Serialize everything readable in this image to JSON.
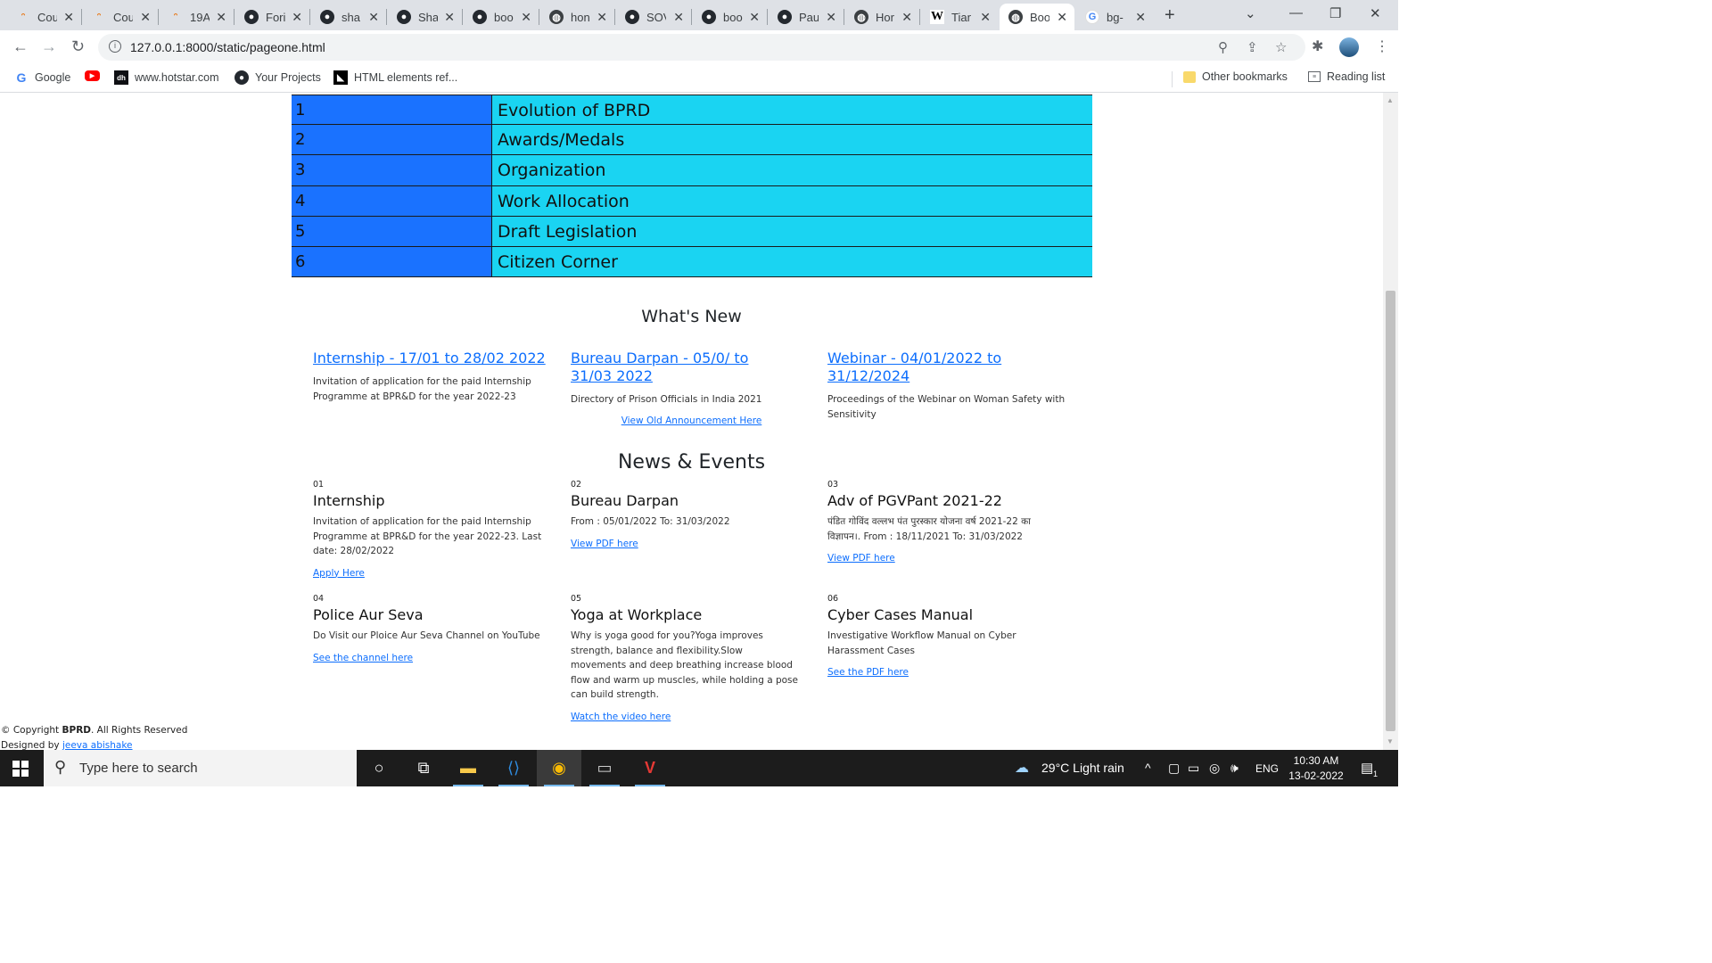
{
  "browser": {
    "tabs": [
      {
        "label": "Cou",
        "icon": "rss-icon"
      },
      {
        "label": "Cou",
        "icon": "rss-icon"
      },
      {
        "label": "19A",
        "icon": "rss-icon"
      },
      {
        "label": "Fori",
        "icon": "github-icon"
      },
      {
        "label": "sha",
        "icon": "github-icon"
      },
      {
        "label": "Sha",
        "icon": "github-icon"
      },
      {
        "label": "boo",
        "icon": "github-icon"
      },
      {
        "label": "hon",
        "icon": "globe-icon"
      },
      {
        "label": "SOV",
        "icon": "github-icon"
      },
      {
        "label": "boo",
        "icon": "github-icon"
      },
      {
        "label": "Pau",
        "icon": "github-icon"
      },
      {
        "label": "Hor",
        "icon": "globe-icon"
      },
      {
        "label": "Tian",
        "icon": "wikipedia-icon"
      },
      {
        "label": "Boo",
        "icon": "globe-icon",
        "active": true
      },
      {
        "label": "bg-",
        "icon": "google-icon"
      }
    ],
    "url": "127.0.0.1:8000/static/pageone.html",
    "bookmarks": [
      {
        "label": "Google",
        "icon": "google-icon"
      },
      {
        "label": "",
        "icon": "youtube-icon"
      },
      {
        "label": "www.hotstar.com",
        "icon": "hotstar-icon"
      },
      {
        "label": "Your Projects",
        "icon": "github-icon"
      },
      {
        "label": "HTML elements ref...",
        "icon": "mdn-icon"
      }
    ],
    "other_bookmarks": "Other bookmarks",
    "reading_list": "Reading list"
  },
  "page": {
    "menu": [
      {
        "num": "1",
        "label": "Evolution of BPRD"
      },
      {
        "num": "2",
        "label": "Awards/Medals"
      },
      {
        "num": "3",
        "label": "Organization"
      },
      {
        "num": "4",
        "label": "Work Allocation"
      },
      {
        "num": "5",
        "label": "Draft Legislation"
      },
      {
        "num": "6",
        "label": "Citizen Corner"
      }
    ],
    "whats_new": {
      "heading": "What's New",
      "items": [
        {
          "title": "Internship - 17/01 to 28/02 2022",
          "desc": "Invitation of application for the paid Internship Programme at BPR&D for the year 2022-23"
        },
        {
          "title": "Bureau Darpan - 05/0/ to 31/03 2022",
          "desc": "Directory of Prison Officials in India 2021"
        },
        {
          "title": "Webinar - 04/01/2022 to 31/12/2024",
          "desc": "Proceedings of the Webinar on Woman Safety with Sensitivity"
        }
      ],
      "old_link": "View Old Announcement Here"
    },
    "news": {
      "heading": "News & Events",
      "items": [
        {
          "num": "01",
          "title": "Internship",
          "desc": "Invitation of application for the paid Internship Programme at BPR&D for the year 2022-23. Last date: 28/02/2022",
          "link": "Apply Here"
        },
        {
          "num": "02",
          "title": "Bureau Darpan",
          "desc": "From : 05/01/2022 To: 31/03/2022",
          "link": "View PDF here"
        },
        {
          "num": "03",
          "title": "Adv of PGVPant 2021-22",
          "desc": "पंडित गोविंद वल्लभ पंत पुरस्कार योजना वर्ष 2021-22 का विज्ञापन।. From : 18/11/2021 To: 31/03/2022",
          "link": "View PDF here"
        },
        {
          "num": "04",
          "title": "Police Aur Seva",
          "desc": "Do Visit our Ploice Aur Seva Channel on YouTube",
          "link": "See the channel here"
        },
        {
          "num": "05",
          "title": "Yoga at Workplace",
          "desc": "Why is yoga good for you?Yoga improves strength, balance and flexibility.Slow movements and deep breathing increase blood flow and warm up muscles, while holding a pose can build strength.",
          "link": "Watch the video here"
        },
        {
          "num": "06",
          "title": "Cyber Cases Manual",
          "desc": "Investigative Workflow Manual on Cyber Harassment Cases",
          "link": "See the PDF here"
        }
      ]
    },
    "footer": {
      "copyright_prefix": "© Copyright",
      "brand": "BPRD",
      "rights": ". All Rights Reserved",
      "designed_by": "Designed by",
      "designer": "jeeva abishake"
    }
  },
  "taskbar": {
    "search_placeholder": "Type here to search",
    "weather": "29°C  Light rain",
    "language": "ENG",
    "time": "10:30 AM",
    "date": "13-02-2022",
    "notification_count": "1"
  }
}
